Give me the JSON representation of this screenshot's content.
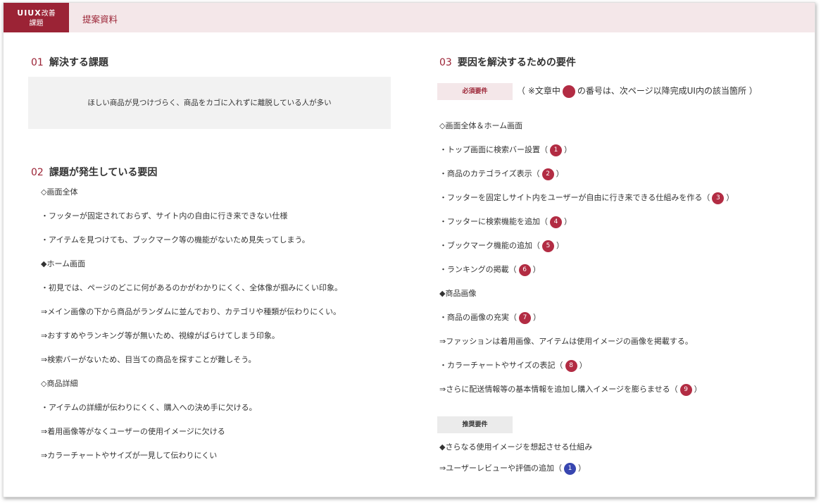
{
  "header": {
    "brand_line1": "UIUX",
    "brand_line1_suffix": "改善",
    "brand_line2": "課題",
    "title": "提案資料"
  },
  "sec1": {
    "num": "01",
    "title": "解決する課題",
    "box_text": "ほしい商品が見つけづらく、商品をカゴに入れずに離脱している人が多い"
  },
  "sec2": {
    "num": "02",
    "title": "課題が発生している要因",
    "lines": [
      "◇画面全体",
      "・フッターが固定されておらず、サイト内の自由に行き来できない仕様",
      "・アイテムを見つけても、ブックマーク等の機能がないため見失ってしまう。",
      "◆ホーム画面",
      "・初見では、ページのどこに何があるのかがわかりにくく、全体像が掴みにくい印象。",
      "⇒メイン画像の下から商品がランダムに並んでおり、カテゴリや種類が伝わりにくい。",
      "⇒おすすめやランキング等が無いため、視線がばらけてしまう印象。",
      "⇒検索バーがないため、目当ての商品を探すことが難しそう。",
      "◇商品詳細",
      "・アイテムの詳細が伝わりにくく、購入への決め手に欠ける。",
      "⇒着用画像等がなくユーザーの使用イメージに欠ける",
      "⇒カラーチャートやサイズが一見して伝わりにくい"
    ]
  },
  "sec3": {
    "num": "03",
    "title": "要因を解決するための要件",
    "required_tag": "必須要件",
    "note_before": "（ ※文章中",
    "note_after": "の番号は、次ページ以降完成UI内の該当箇所 ）",
    "lines": [
      {
        "text": "◇画面全体＆ホーム画面",
        "badge": null
      },
      {
        "text": "・トップ画面に検索バー設置（",
        "badge": "1"
      },
      {
        "text": "・商品のカテゴライズ表示（",
        "badge": "2"
      },
      {
        "text": "・フッターを固定しサイト内をユーザーが自由に行き来できる仕組みを作る（",
        "badge": "3"
      },
      {
        "text": "・フッターに検索機能を追加（",
        "badge": "4"
      },
      {
        "text": "・ブックマーク機能の追加（",
        "badge": "5"
      },
      {
        "text": "・ランキングの掲載（",
        "badge": "6"
      },
      {
        "text": "◆商品画像",
        "badge": null
      },
      {
        "text": "・商品の画像の充実（",
        "badge": "7"
      },
      {
        "text": "⇒ファッションは着用画像、アイテムは使用イメージの画像を掲載する。",
        "badge": null
      },
      {
        "text": "・カラーチャートやサイズの表記（",
        "badge": "8"
      },
      {
        "text": "⇒さらに配送情報等の基本情報を追加し購入イメージを膨らませる（",
        "badge": "9"
      }
    ],
    "close_paren": "）",
    "recommended_tag": "推奨要件",
    "rec_lines": [
      {
        "text": "◆さらなる使用イメージを想起させる仕組み",
        "badge": null
      },
      {
        "text": "⇒ユーザーレビューや評価の追加（",
        "badge": "1"
      }
    ]
  },
  "colors": {
    "accent": "#9b2335",
    "badge_red": "#b22c43",
    "badge_blue": "#3846b0",
    "header_bg": "#f4e7e9"
  }
}
